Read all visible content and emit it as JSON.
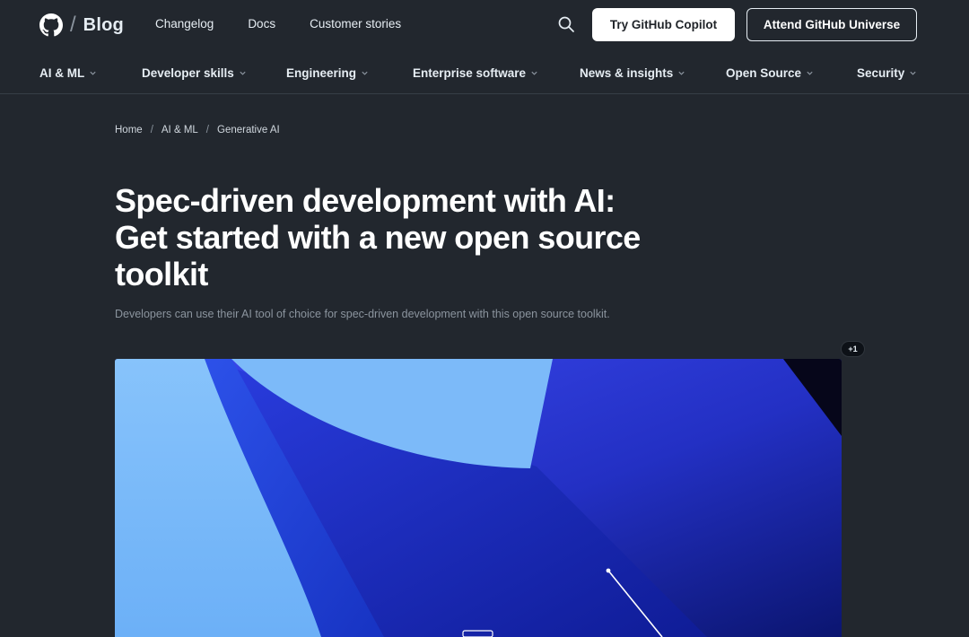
{
  "header": {
    "logo_text": "Blog",
    "logo_slash": "/",
    "links": [
      "Changelog",
      "Docs",
      "Customer stories"
    ],
    "cta_primary": "Try GitHub Copilot",
    "cta_secondary": "Attend GitHub Universe"
  },
  "categories": [
    "AI & ML",
    "Developer skills",
    "Engineering",
    "Enterprise software",
    "News & insights",
    "Open Source",
    "Security"
  ],
  "breadcrumb": {
    "items": [
      "Home",
      "AI & ML",
      "Generative AI"
    ],
    "separator": "/"
  },
  "article": {
    "title_line1": "Spec-driven development with AI:",
    "title_line2": "Get started with a new open source",
    "title_line3": "toolkit",
    "subtitle": "Developers can use their AI tool of choice for spec-driven development with this open source toolkit."
  },
  "badge": {
    "label": "+1"
  },
  "icons": {
    "logo": "github-mark-icon",
    "search": "search-icon",
    "chevron": "chevron-down-icon"
  },
  "colors": {
    "background": "#22272e",
    "text": "#ffffff",
    "muted": "#8b949e",
    "hero_light": "#7fbcfa",
    "hero_mid": "#3d4fe6",
    "hero_dark": "#0b1570"
  }
}
